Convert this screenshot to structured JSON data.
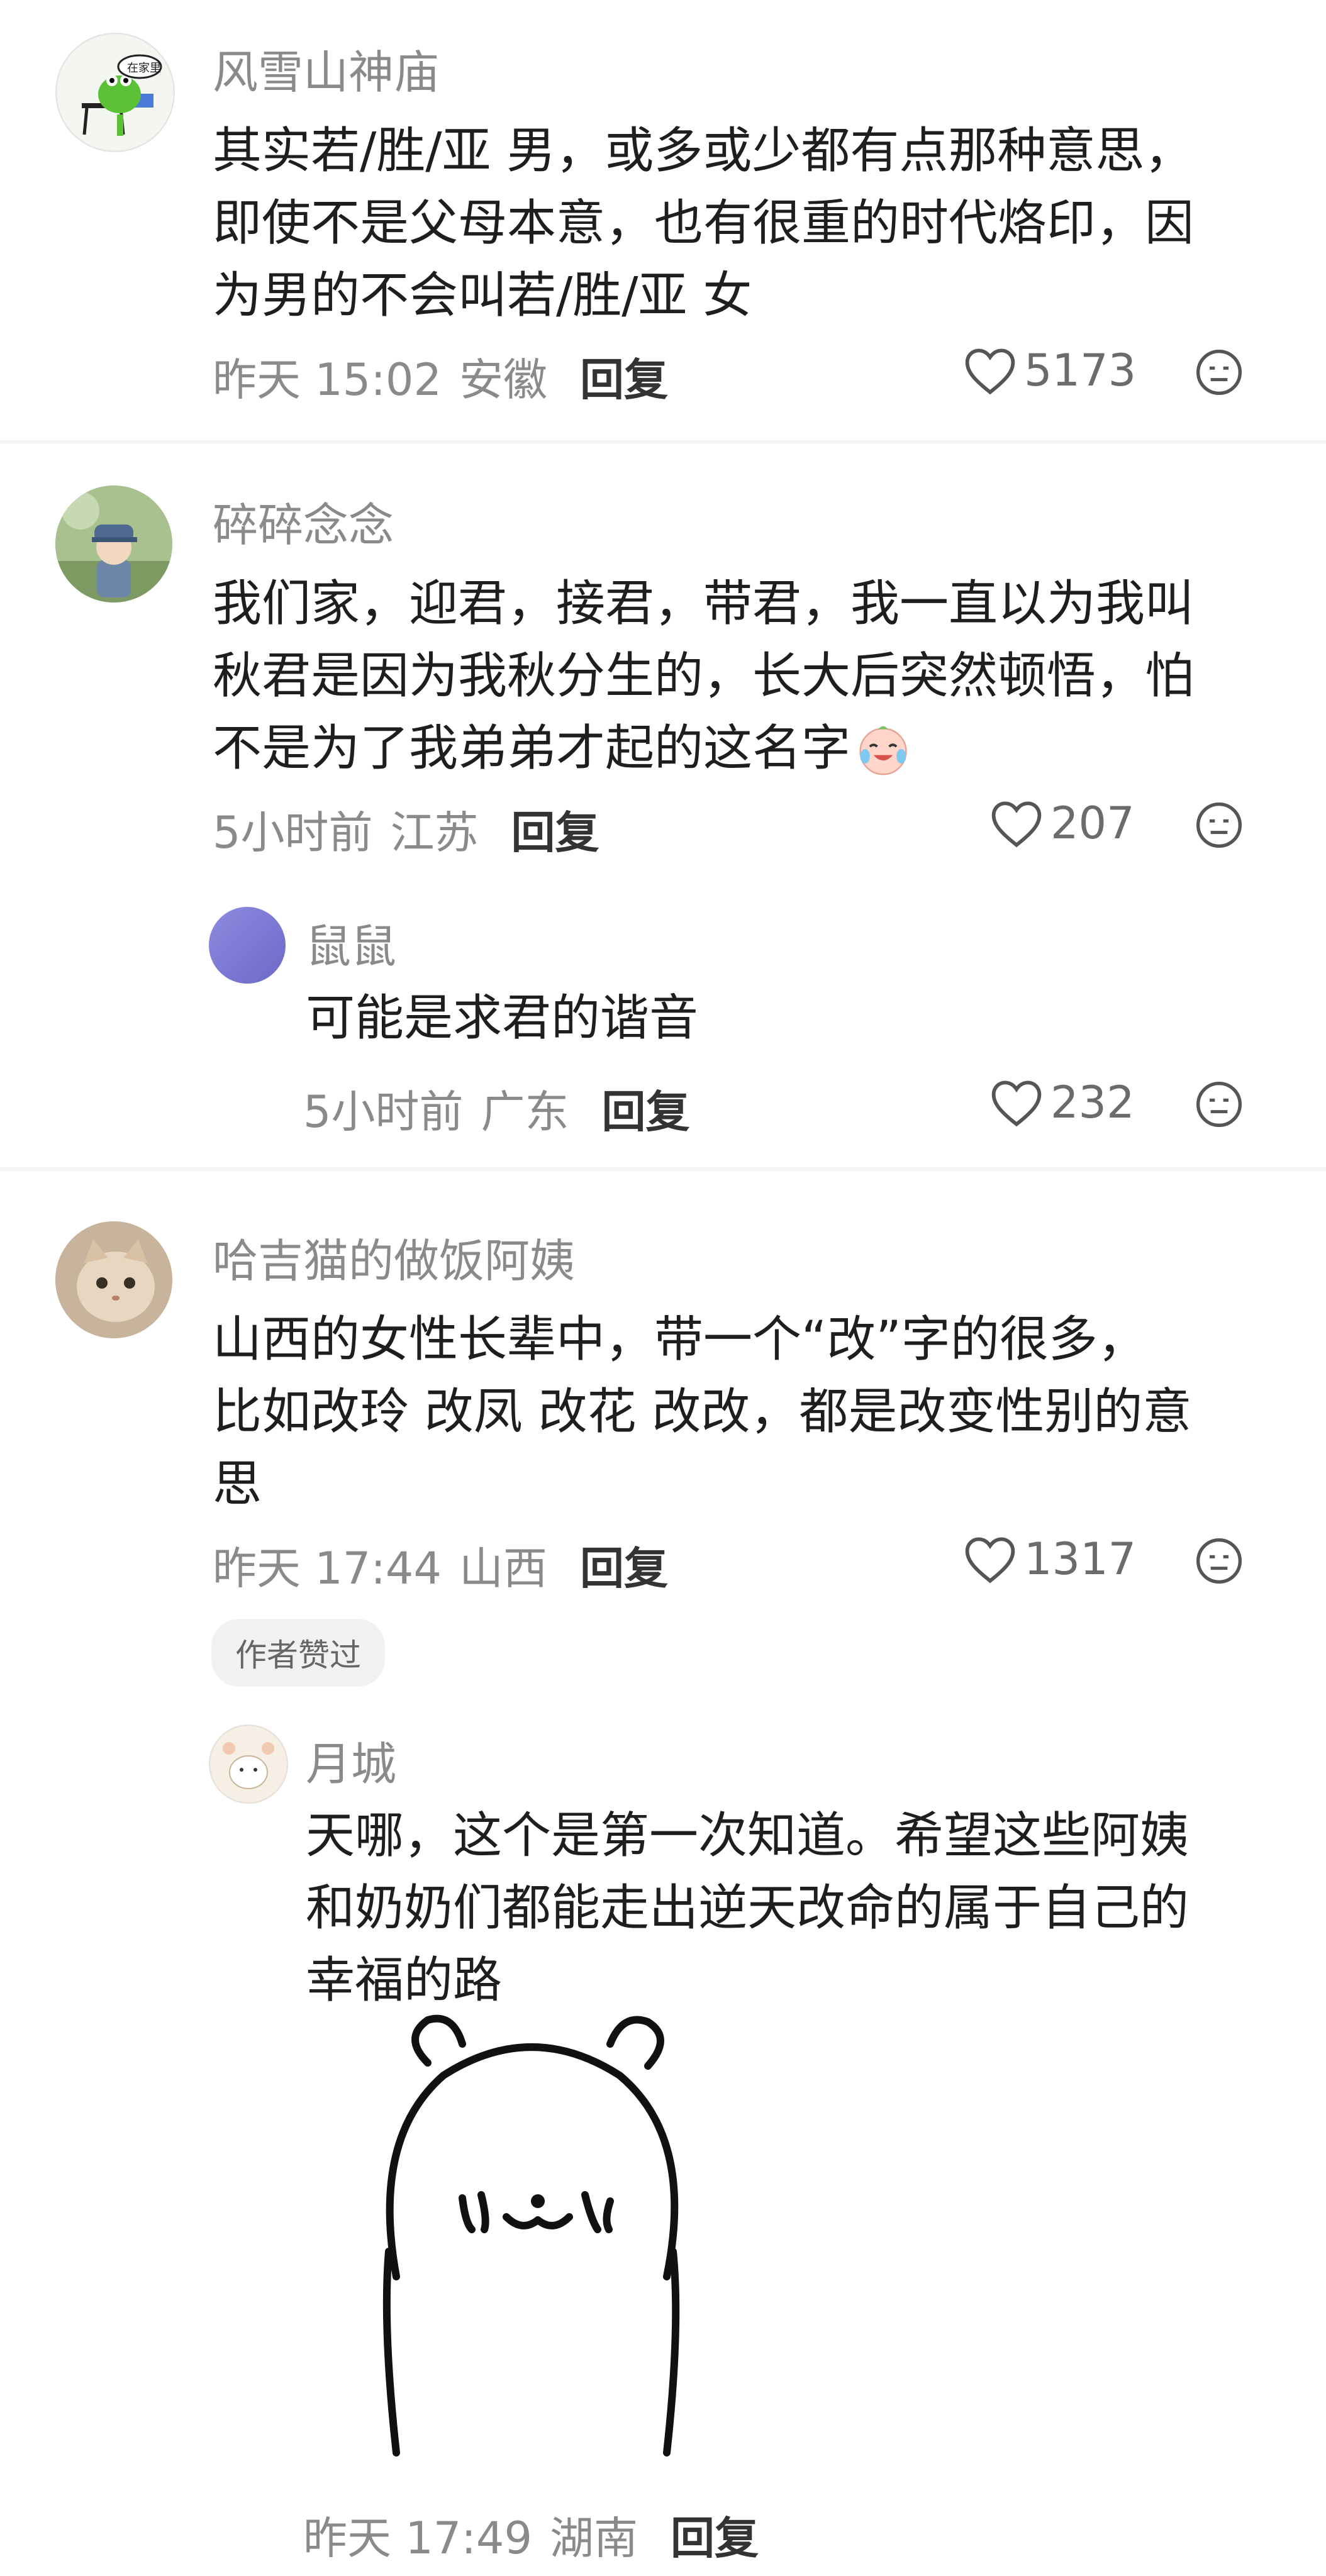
{
  "comments": [
    {
      "username": "风雪山神庙",
      "lines": [
        "其实若/胜/亚 男，或多或少都有点那种意思，",
        "即使不是父母本意，也有很重的时代烙印，因",
        "为男的不会叫若/胜/亚 女"
      ],
      "time": "昨天 15:02",
      "location": "安徽",
      "reply": "回复",
      "likes": "5173",
      "avatar_sign": "在家里"
    },
    {
      "username": "碎碎念念",
      "lines": [
        "我们家，迎君，接君，带君，我一直以为我叫",
        "秋君是因为我秋分生的，长大后突然顿悟，怕",
        "不是为了我弟弟才起的这名字"
      ],
      "time": "5小时前",
      "location": "江苏",
      "reply": "回复",
      "likes": "207",
      "replies": [
        {
          "username": "鼠鼠",
          "text": "可能是求君的谐音",
          "time": "5小时前",
          "location": "广东",
          "reply": "回复",
          "likes": "232"
        }
      ]
    },
    {
      "username": "哈吉猫的做饭阿姨",
      "lines": [
        "山西的女性长辈中，带一个“改”字的很多，",
        "比如改玲 改凤 改花 改改，都是改变性别的意",
        "思"
      ],
      "time": "昨天 17:44",
      "location": "山西",
      "reply": "回复",
      "likes": "1317",
      "badge": "作者赞过",
      "replies": [
        {
          "username": "月城",
          "lines": [
            "天哪，这个是第一次知道。希望这些阿姨",
            "和奶奶们都能走出逆天改命的属于自己的",
            "幸福的路"
          ],
          "time": "昨天 17:49",
          "location": "湖南",
          "reply": "回复"
        }
      ]
    }
  ]
}
